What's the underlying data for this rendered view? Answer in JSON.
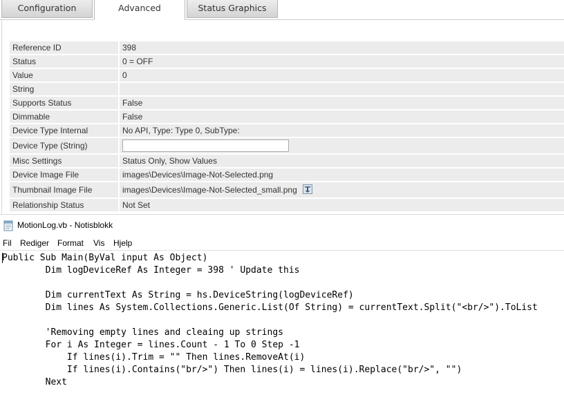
{
  "tabs": [
    {
      "label": "Configuration",
      "active": false
    },
    {
      "label": "Advanced",
      "active": true
    },
    {
      "label": "Status Graphics",
      "active": false
    }
  ],
  "properties": {
    "reference_id": {
      "label": "Reference ID",
      "value": "398"
    },
    "status": {
      "label": "Status",
      "value": "0 = OFF"
    },
    "value": {
      "label": "Value",
      "value": "0"
    },
    "string": {
      "label": "String",
      "value": ""
    },
    "supports_status": {
      "label": "Supports Status",
      "value": "False"
    },
    "dimmable": {
      "label": "Dimmable",
      "value": "False"
    },
    "device_type_internal": {
      "label": "Device Type Internal",
      "value": "No API, Type: Type 0, SubType:"
    },
    "device_type_string": {
      "label": "Device Type (String)",
      "value": ""
    },
    "misc_settings": {
      "label": "Misc Settings",
      "value": "Status Only, Show Values"
    },
    "device_image_file": {
      "label": "Device Image File",
      "value": "images\\Devices\\Image-Not-Selected.png"
    },
    "thumbnail_image_file": {
      "label": "Thumbnail Image File",
      "value": "images\\Devices\\Image-Not-Selected_small.png"
    },
    "relationship_status": {
      "label": "Relationship Status",
      "value": "Not Set"
    }
  },
  "notepad": {
    "title": "MotionLog.vb - Notisblokk",
    "menu": [
      "Fil",
      "Rediger",
      "Format",
      "Vis",
      "Hjelp"
    ],
    "lines": [
      "Public Sub Main(ByVal input As Object)",
      "        Dim logDeviceRef As Integer = 398 ' Update this",
      "",
      "        Dim currentText As String = hs.DeviceString(logDeviceRef)",
      "        Dim lines As System.Collections.Generic.List(Of String) = currentText.Split(\"<br/>\").ToList",
      "",
      "        'Removing empty lines and cleaing up strings",
      "        For i As Integer = lines.Count - 1 To 0 Step -1",
      "            If lines(i).Trim = \"\" Then lines.RemoveAt(i)",
      "            If lines(i).Contains(\"br/>\") Then lines(i) = lines(i).Replace(\"br/>\", \"\")",
      "        Next"
    ]
  }
}
